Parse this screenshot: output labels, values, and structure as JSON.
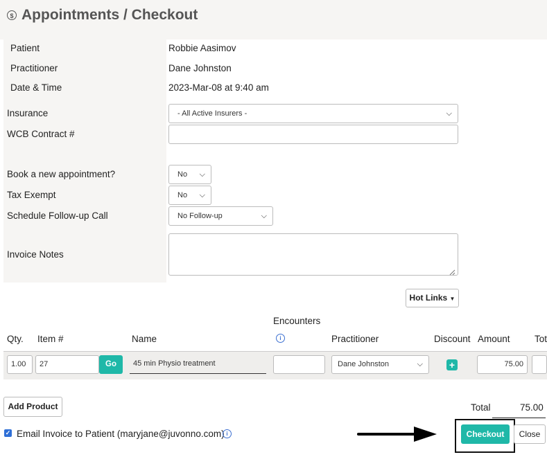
{
  "header": {
    "title": "Appointments / Checkout",
    "icon": "dollar-circle-icon"
  },
  "details": {
    "patient_label": "Patient",
    "patient_value": "Robbie Aasimov",
    "practitioner_label": "Practitioner",
    "practitioner_value": "Dane Johnston",
    "datetime_label": "Date & Time",
    "datetime_value": "2023-Mar-08 at 9:40 am"
  },
  "form": {
    "insurance_label": "Insurance",
    "insurance_value": "- All Active Insurers -",
    "wcb_label": "WCB Contract #",
    "wcb_value": "",
    "book_label": "Book a new appointment?",
    "book_value": "No",
    "tax_label": "Tax Exempt",
    "tax_value": "No",
    "followup_label": "Schedule Follow-up Call",
    "followup_value": "No Follow-up",
    "notes_label": "Invoice Notes",
    "notes_value": ""
  },
  "hot_links": {
    "label": "Hot Links"
  },
  "table": {
    "headers": {
      "qty": "Qty.",
      "item": "Item #",
      "name": "Name",
      "encounters": "Encounters",
      "practitioner": "Practitioner",
      "discount": "Discount",
      "amount": "Amount",
      "total": "Tot"
    },
    "row": {
      "qty": "1.00",
      "item": "27",
      "go": "Go",
      "name": "45 min Physio treatment",
      "encounters": "",
      "practitioner": "Dane Johnston",
      "amount": "75.00"
    }
  },
  "add_product": {
    "label": "Add Product"
  },
  "totals": {
    "label": "Total",
    "value": "75.00"
  },
  "email": {
    "label": "Email Invoice to Patient (maryjane@juvonno.com)",
    "checked": true
  },
  "actions": {
    "checkout": "Checkout",
    "close": "Close"
  },
  "colors": {
    "accent": "#1fb8a8",
    "band": "#f6f5f3",
    "info": "#3b6fd1"
  }
}
